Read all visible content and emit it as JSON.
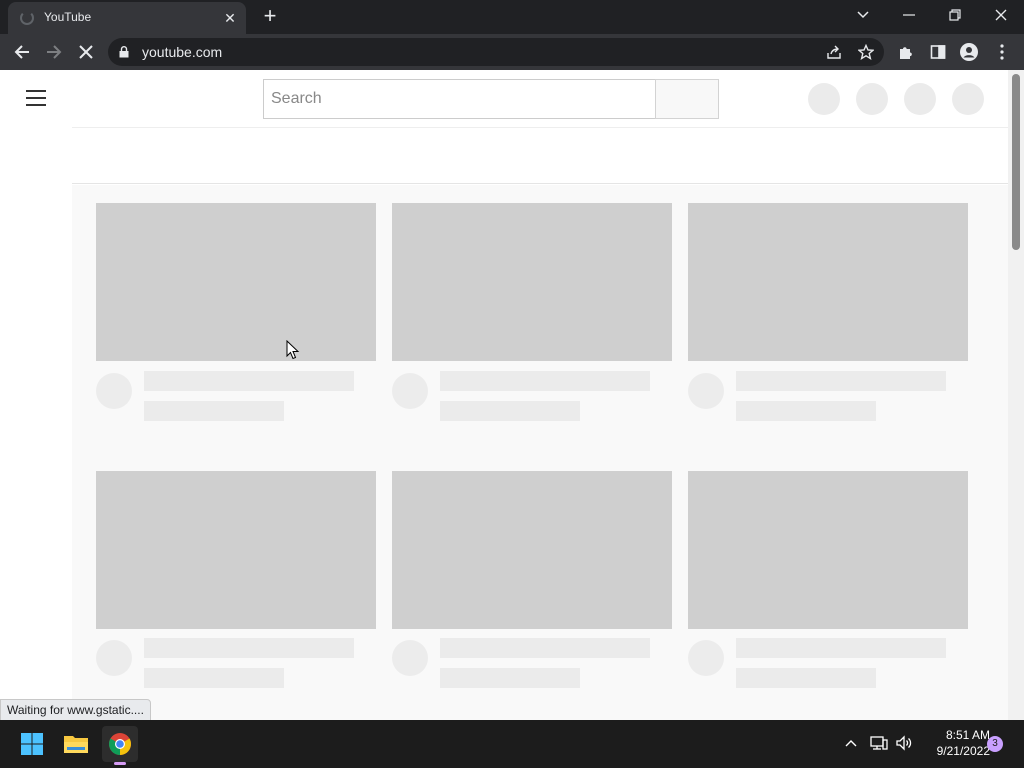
{
  "browser": {
    "tab": {
      "title": "YouTube"
    },
    "new_tab_label": "+",
    "address": {
      "url": "youtube.com"
    },
    "status_text": "Waiting for www.gstatic...."
  },
  "page": {
    "search": {
      "placeholder": "Search"
    },
    "header_placeholders": 4,
    "feed_rows": 2,
    "feed_columns": 3
  },
  "taskbar": {
    "time": "8:51 AM",
    "date": "9/21/2022",
    "notification_count": "3",
    "pinned": [
      "windows-start-icon",
      "file-explorer-icon",
      "chrome-icon"
    ]
  },
  "colors": {
    "titlebar": "#202124",
    "toolbar": "#35363a",
    "skeleton_thumb": "#cfcfcf",
    "skeleton_line": "#ebebeb",
    "feed_bg": "#f9f9f9",
    "taskbar": "#1c1c1c"
  }
}
